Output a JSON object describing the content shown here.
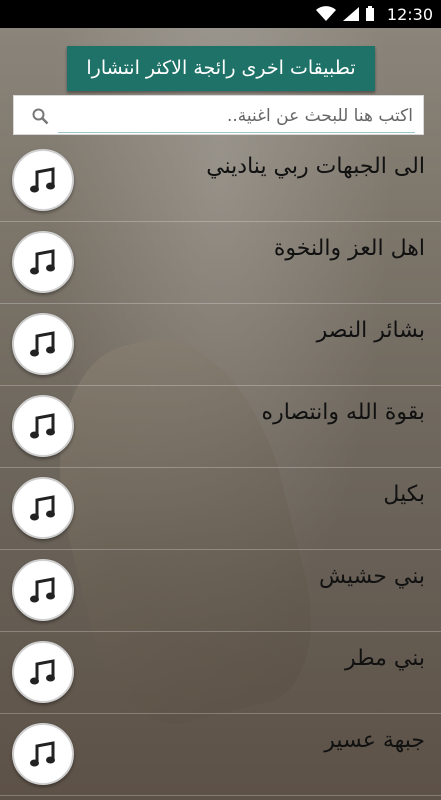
{
  "status": {
    "time": "12:30"
  },
  "promo": {
    "label": "تطبيقات اخرى رائجة الاكثر انتشارا"
  },
  "search": {
    "placeholder": "اكتب هنا للبحث عن اغنية.."
  },
  "songs": [
    {
      "title": "الى الجبهات ربي يناديني",
      "icon": "music-note-icon"
    },
    {
      "title": "اهل العز والنخوة",
      "icon": "music-note-icon"
    },
    {
      "title": "بشائر النصر",
      "icon": "music-note-icon"
    },
    {
      "title": "بقوة الله وانتصاره",
      "icon": "music-note-icon"
    },
    {
      "title": "بكيل",
      "icon": "music-note-icon"
    },
    {
      "title": "بني حشيش",
      "icon": "music-note-icon"
    },
    {
      "title": "بني مطر",
      "icon": "music-note-icon"
    },
    {
      "title": "جبهة عسير",
      "icon": "music-note-icon"
    }
  ],
  "colors": {
    "promo_bg": "#1f7268",
    "accent": "#9dc9c4"
  }
}
